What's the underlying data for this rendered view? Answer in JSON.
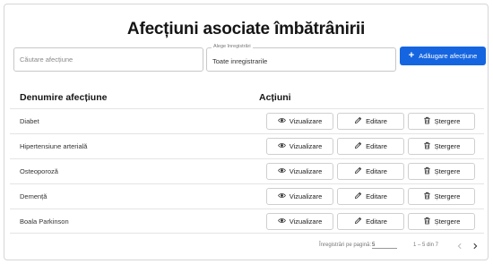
{
  "title": "Afecțiuni asociate îmbătrânirii",
  "search": {
    "placeholder": "Căutare afecțiune"
  },
  "filter": {
    "legend": "Alege înregistrări",
    "value": "Toate inregistrarile"
  },
  "add_button": {
    "label": "Adăugare afecțiune",
    "icon": "plus-icon"
  },
  "table": {
    "headers": {
      "name": "Denumire afecțiune",
      "actions": "Acțiuni"
    },
    "rows": [
      {
        "name": "Diabet"
      },
      {
        "name": "Hipertensiune arterială"
      },
      {
        "name": "Osteoporoză"
      },
      {
        "name": "Demență"
      },
      {
        "name": "Boala Parkinson"
      }
    ],
    "actions": {
      "view": "Vizualizare",
      "edit": "Editare",
      "delete": "Ștergere"
    }
  },
  "pagination": {
    "label": "Înregistrări pe pagină:",
    "per_page": "5",
    "range": "1 – 5 din 7"
  },
  "colors": {
    "accent": "#1565e0",
    "border": "#d6d6d6"
  }
}
